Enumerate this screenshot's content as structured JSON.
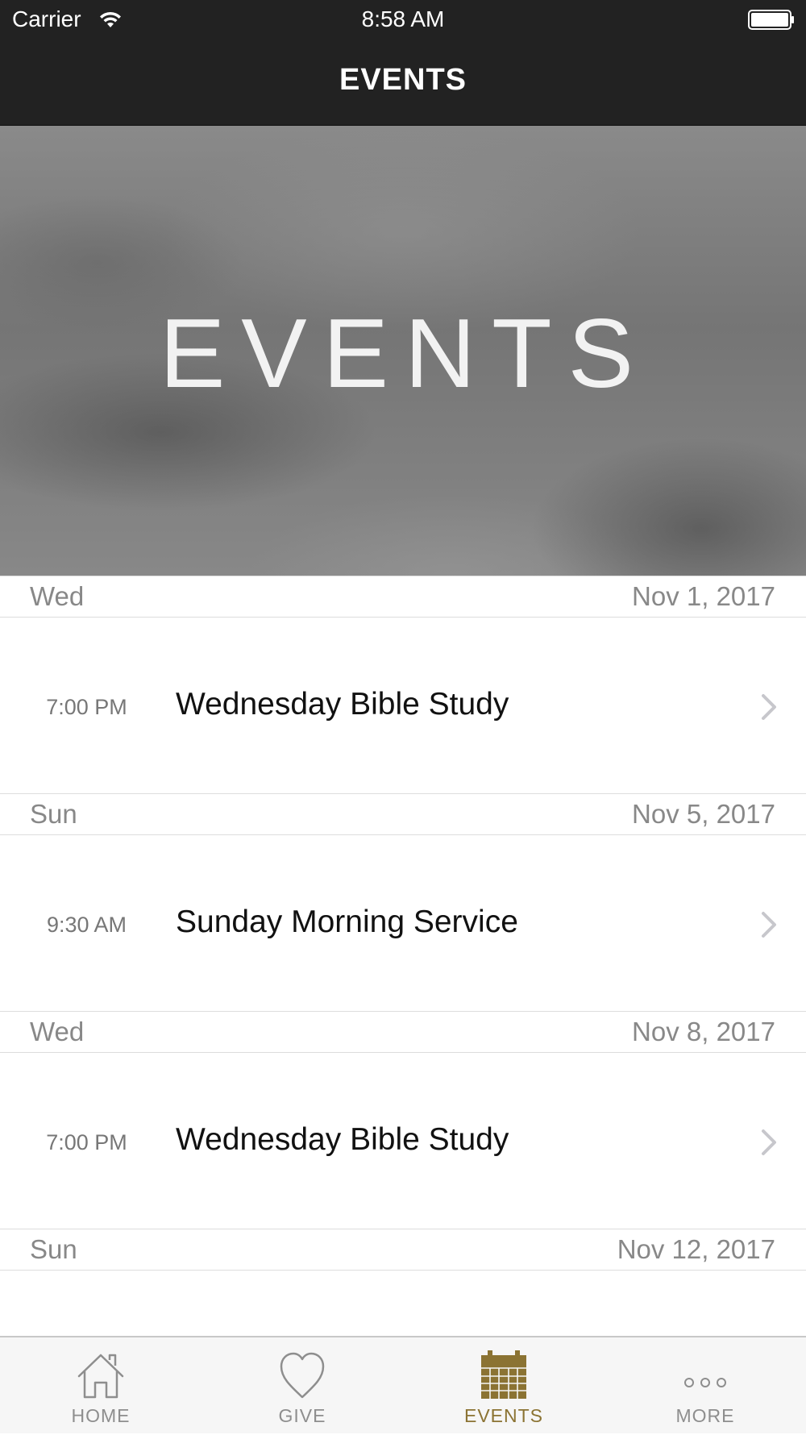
{
  "status_bar": {
    "carrier": "Carrier",
    "time": "8:58 AM"
  },
  "nav": {
    "title": "EVENTS"
  },
  "hero": {
    "title": "EVENTS"
  },
  "schedule": [
    {
      "day": "Wed",
      "date": "Nov 1, 2017",
      "events": [
        {
          "time": "7:00 PM",
          "name": "Wednesday Bible Study"
        }
      ]
    },
    {
      "day": "Sun",
      "date": "Nov 5, 2017",
      "events": [
        {
          "time": "9:30 AM",
          "name": "Sunday Morning Service"
        }
      ]
    },
    {
      "day": "Wed",
      "date": "Nov 8, 2017",
      "events": [
        {
          "time": "7:00 PM",
          "name": "Wednesday Bible Study"
        }
      ]
    },
    {
      "day": "Sun",
      "date": "Nov 12, 2017",
      "events": []
    }
  ],
  "tabs": [
    {
      "label": "HOME",
      "icon": "home-icon",
      "active": false
    },
    {
      "label": "GIVE",
      "icon": "heart-icon",
      "active": false
    },
    {
      "label": "EVENTS",
      "icon": "calendar-icon",
      "active": true
    },
    {
      "label": "MORE",
      "icon": "more-icon",
      "active": false
    }
  ],
  "colors": {
    "bar_background": "#222222",
    "active_tab": "#8b7333",
    "inactive_tab": "#8e8e8e"
  }
}
